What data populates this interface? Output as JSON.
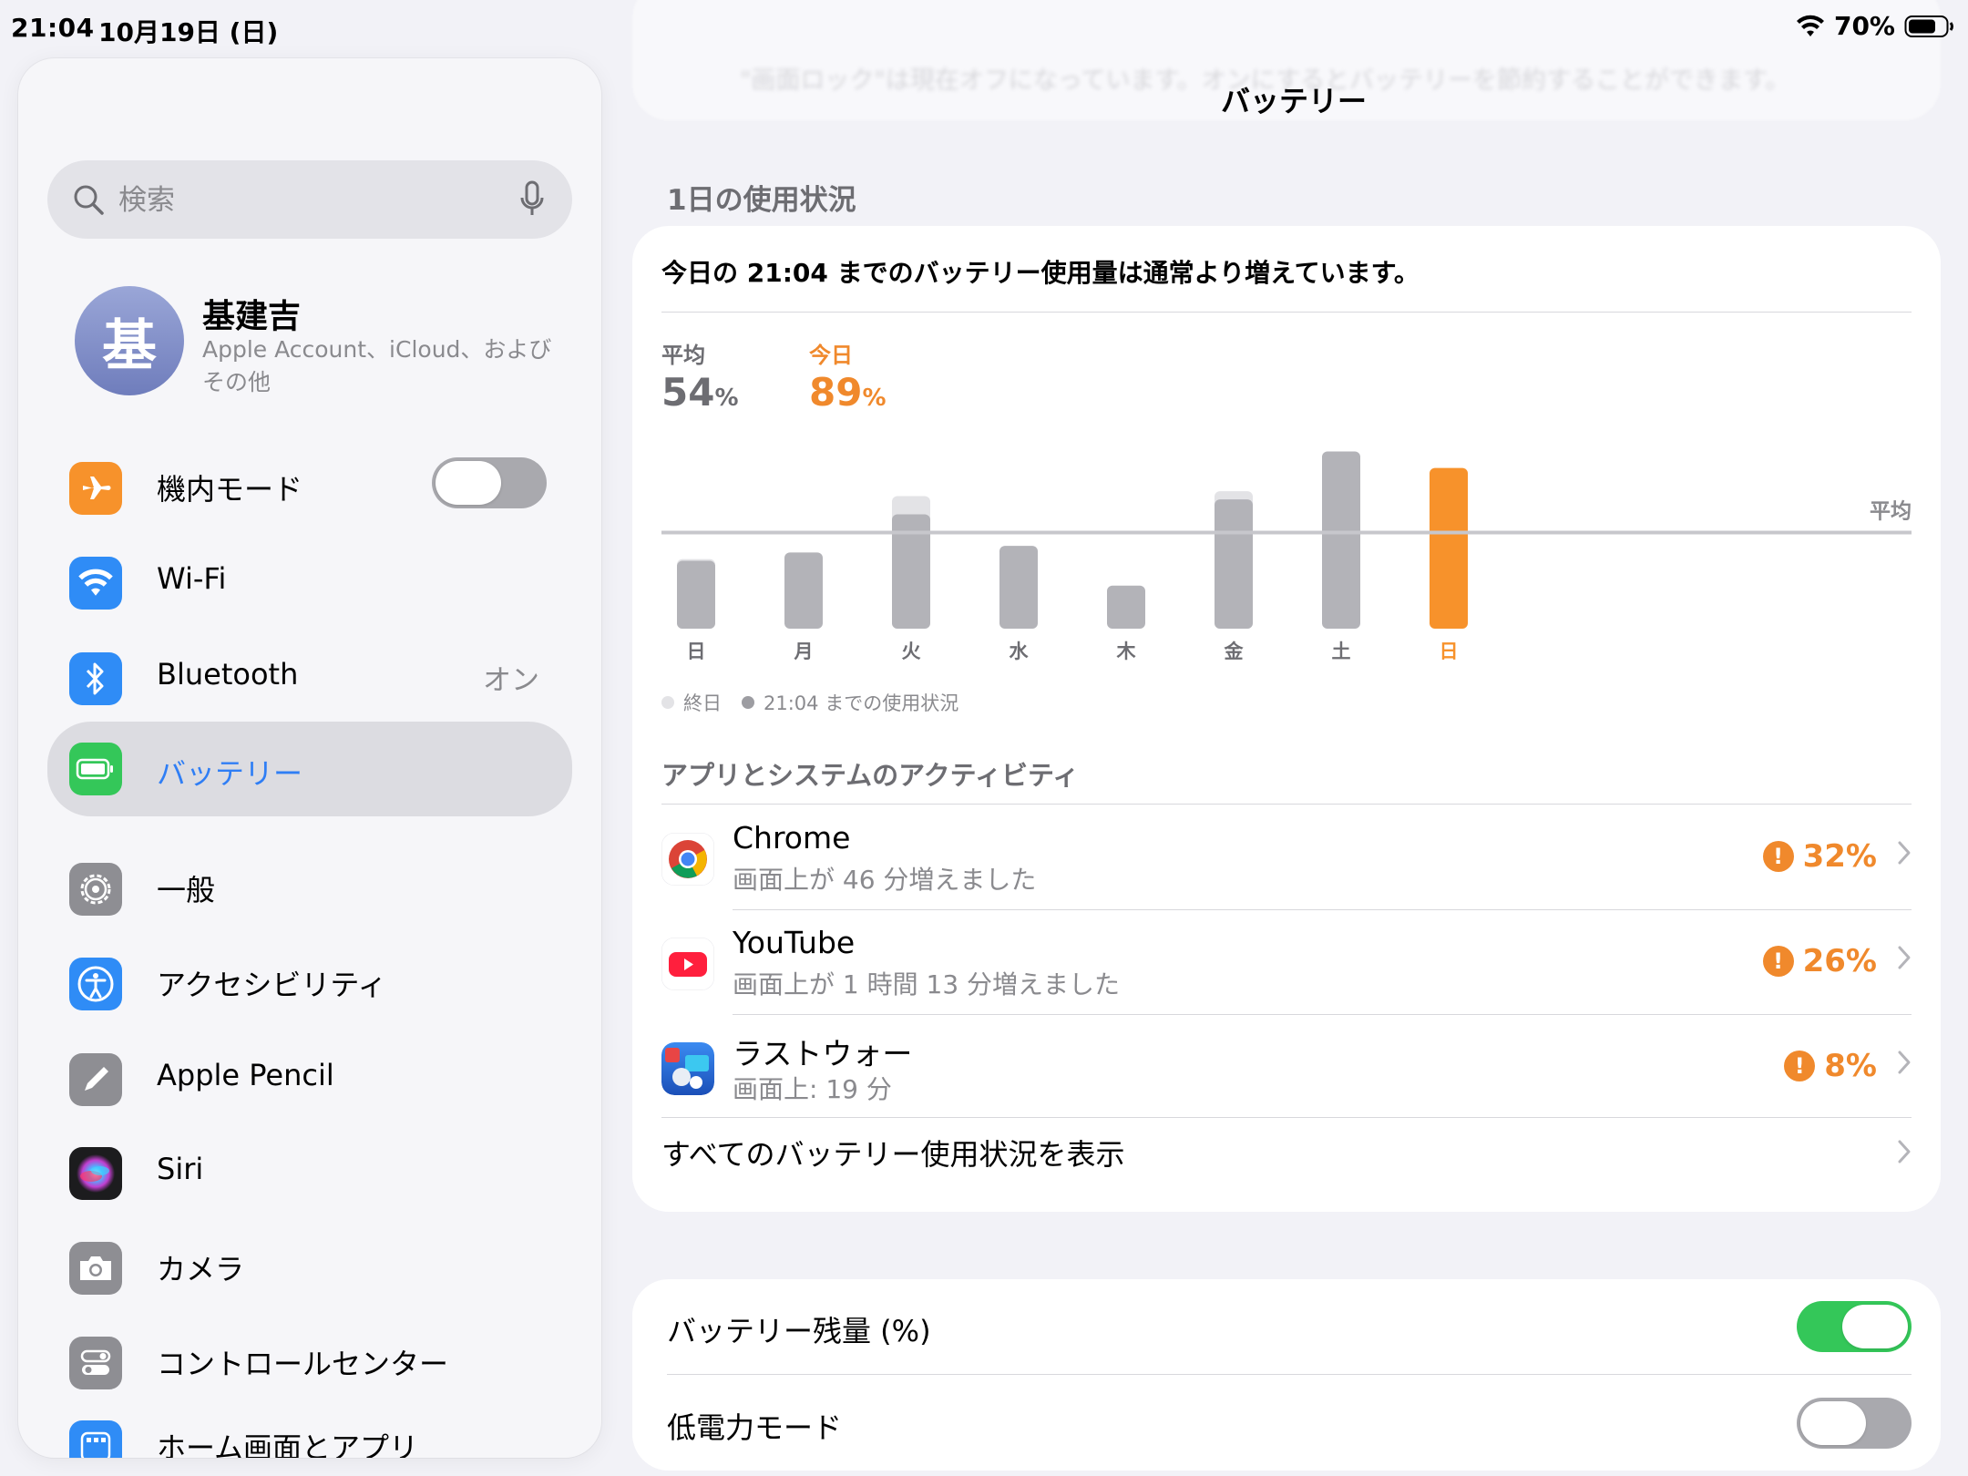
{
  "status": {
    "time": "21:04",
    "date": "10月19日 (日)",
    "battery_pct": "70%"
  },
  "sidebar": {
    "search": {
      "placeholder": "検索"
    },
    "profile": {
      "initial": "基",
      "name": "基建吉",
      "subtitle": "Apple Account、iCloud、および その他"
    },
    "items": [
      {
        "label": "機内モード",
        "icon": "airplane-icon",
        "color": "#f7922b",
        "toggle": "off"
      },
      {
        "label": "Wi-Fi",
        "icon": "wifi-icon",
        "color": "#2f8cf6"
      },
      {
        "label": "Bluetooth",
        "icon": "bluetooth-icon",
        "color": "#2f8cf6",
        "value": "オン"
      },
      {
        "label": "バッテリー",
        "icon": "battery-icon",
        "color": "#34c759",
        "selected": true
      },
      {
        "label": "一般",
        "icon": "gear-icon",
        "color": "#8e8e93"
      },
      {
        "label": "アクセシビリティ",
        "icon": "accessibility-icon",
        "color": "#2f8cf6"
      },
      {
        "label": "Apple Pencil",
        "icon": "pencil-icon",
        "color": "#8e8e93"
      },
      {
        "label": "Siri",
        "icon": "siri-icon",
        "color": "#1c1c1e"
      },
      {
        "label": "カメラ",
        "icon": "camera-icon",
        "color": "#8e8e93"
      },
      {
        "label": "コントロールセンター",
        "icon": "control-center-icon",
        "color": "#8e8e93"
      },
      {
        "label": "ホーム画面とアプリ",
        "icon": "home-screen-icon",
        "color": "#2f8cf6"
      }
    ]
  },
  "main": {
    "title": "バッテリー",
    "faded_notice": "\"画面ロック\"は現在オフになっています。オンにするとバッテリーを節約することができます。",
    "section_title": "1日の使用状況",
    "headline": "今日の 21:04 までのバッテリー使用量は通常より増えています。",
    "average": {
      "label": "平均",
      "value": "54",
      "unit": "%"
    },
    "today": {
      "label": "今日",
      "value": "89",
      "unit": "%"
    },
    "legend": {
      "full_day": "終日",
      "until_now": "21:04 までの使用状況"
    },
    "activity_title": "アプリとシステムのアクティビティ",
    "apps": [
      {
        "name": "Chrome",
        "detail": "画面上が 46 分増えました",
        "pct": "32%",
        "icon": "chrome-icon"
      },
      {
        "name": "YouTube",
        "detail": "画面上が 1 時間 13 分増えました",
        "pct": "26%",
        "icon": "youtube-icon"
      },
      {
        "name": "ラストウォー",
        "detail": "画面上: 19 分",
        "pct": "8%",
        "icon": "last-war-icon"
      }
    ],
    "view_all": "すべてのバッテリー使用状況を表示",
    "settings": [
      {
        "label": "バッテリー残量 (%)",
        "toggle": "on"
      },
      {
        "label": "低電力モード",
        "toggle": "off"
      }
    ]
  },
  "chart_data": {
    "type": "bar",
    "categories": [
      "日",
      "月",
      "火",
      "水",
      "木",
      "金",
      "土",
      "日"
    ],
    "series": [
      {
        "name": "終日",
        "values": [
          42,
          46,
          80,
          50,
          26,
          83,
          107,
          97
        ]
      },
      {
        "name": "21:04 までの使用状況",
        "values": [
          41,
          46,
          69,
          50,
          26,
          78,
          107,
          97
        ]
      }
    ],
    "average_label": "平均",
    "average": 58,
    "highlight_index": 7,
    "colors": {
      "full_day": "#e3e3e6",
      "until_now": "#b3b3b8",
      "today": "#f7922b",
      "average_line": "#c7c7cc"
    },
    "ylim": [
      0,
      110
    ]
  }
}
